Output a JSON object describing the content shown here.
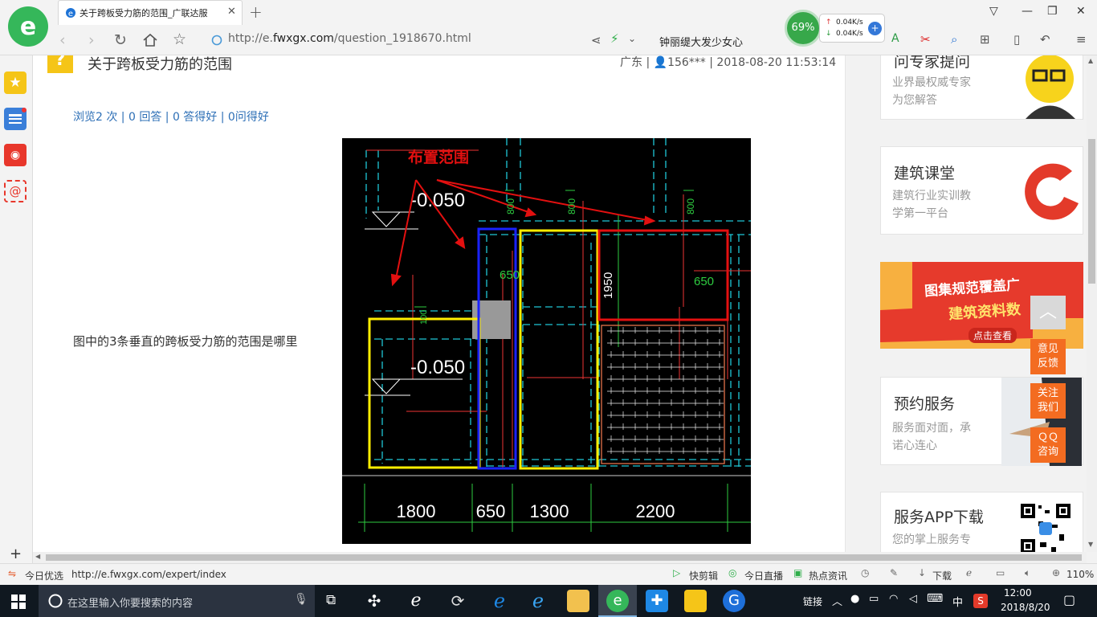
{
  "browser": {
    "tab_title": "关于跨板受力筋的范围_广联达服",
    "url": "http://e.fwxgx.com/question_1918670.html",
    "url_host": "http://e.",
    "url_rest": "fwxgx.com",
    "url_path": "/question_1918670.html",
    "search_suggestion": "钟丽缇大发少女心",
    "speed_percent": "69%",
    "net_up": "0.04K/s",
    "net_down": "0.04K/s"
  },
  "question": {
    "title": "关于跨板受力筋的范围",
    "meta": "广东 | ",
    "user": "156***",
    "datetime": " | 2018-08-20 11:53:14",
    "stats": "浏览2 次 | 0 回答 | 0 答得好 | 0问得好",
    "text": "图中的3条垂直的跨板受力筋的范围是哪里"
  },
  "drawing": {
    "annotation": "布置范围",
    "elev1": "-0.050",
    "elev2": "-0.050",
    "dims": [
      "1800",
      "650",
      "1300",
      "2200"
    ],
    "label_650a": "650",
    "label_650b": "650",
    "label_1950": "1950",
    "label_800a": "800",
    "label_800b": "800",
    "label_800c": "800",
    "label_100": "100"
  },
  "sidebar": {
    "cards": [
      {
        "title": "问专家提问",
        "sub1": "业界最权威专家",
        "sub2": "为您解答"
      },
      {
        "title": "建筑课堂",
        "sub1": "建筑行业实训教",
        "sub2": "学第一平台"
      },
      {
        "title": "图集规范覆盖广",
        "sub1": "建筑资料数",
        "sub2": "点击查看"
      },
      {
        "title": "预约服务",
        "sub1": "服务面对面，承",
        "sub2": "诺心连心"
      },
      {
        "title": "服务APP下载",
        "sub1": "您的掌上服务专",
        "sub2": ""
      }
    ],
    "float_feedback_1": "意见",
    "float_feedback_2": "反馈",
    "float_follow_1": "关注",
    "float_follow_2": "我们",
    "float_qq_1": "ＱＱ",
    "float_qq_2": "咨询"
  },
  "statusbar": {
    "left_label": "今日优选",
    "link": "http://e.fwxgx.com/expert/index",
    "kuaijianji": "快剪辑",
    "live": "今日直播",
    "hot": "热点资讯",
    "download": "下载",
    "zoom": "110%"
  },
  "taskbar": {
    "search_placeholder": "在这里输入你要搜索的内容",
    "link_label": "链接",
    "ime": "中",
    "time": "12:00",
    "date": "2018/8/20"
  },
  "colors": {
    "accent_green": "#35b75a",
    "link_blue": "#2d6fb6",
    "float_orange": "#f36c21"
  }
}
